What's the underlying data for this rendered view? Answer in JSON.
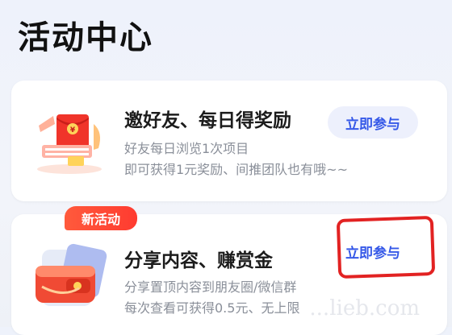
{
  "page": {
    "title": "活动中心"
  },
  "cards": [
    {
      "title": "邀好友、每日得奖励",
      "desc_lines": [
        "好友每日浏览1次项目",
        "即可获得1元奖励、间推团队也有哦~~"
      ],
      "button_label": "立即参与",
      "icon": "red-envelope-gift-icon"
    },
    {
      "badge": "新活动",
      "title": "分享内容、赚赏金",
      "desc_lines": [
        "分享置顶内容到朋友圈/微信群",
        "每次查看可获得0.5元、无上限"
      ],
      "button_label": "立即参与",
      "icon": "red-wallet-icon"
    }
  ],
  "watermark": "...lieb.com",
  "colors": {
    "accent": "#3659e8",
    "badge": "#ff4433",
    "highlight": "#e22222"
  }
}
